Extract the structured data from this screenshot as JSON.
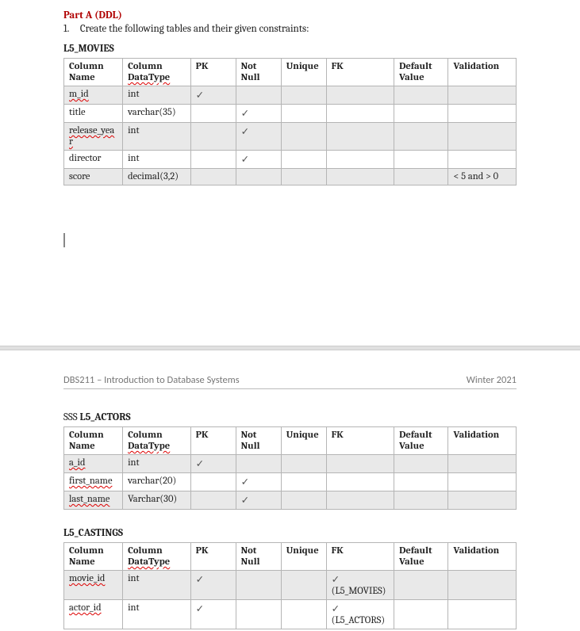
{
  "partA": {
    "title": "Part A (DDL)",
    "item1_num": "1.",
    "item1_text": "Create the following tables and their given constraints:"
  },
  "headers": {
    "col_name": "Column Name",
    "col_type": "Column ",
    "col_type2": "DataType",
    "pk": "PK",
    "not_null": "Not Null",
    "unique": "Unique",
    "fk": "FK",
    "default": "Default Value",
    "validation": "Validation"
  },
  "check": "✓",
  "movies": {
    "caption": "L5_MOVIES",
    "rows": [
      {
        "name": "m_id",
        "name_err": true,
        "type": "int",
        "pk": true,
        "nn": false,
        "uq": "",
        "fk": "",
        "def": "",
        "val": ""
      },
      {
        "name": "title",
        "name_err": false,
        "type": "varchar(35)",
        "pk": false,
        "nn": true,
        "uq": "",
        "fk": "",
        "def": "",
        "val": ""
      },
      {
        "name": "release_year",
        "name_err": true,
        "type": "int",
        "pk": false,
        "nn": true,
        "uq": "",
        "fk": "",
        "def": "",
        "val": ""
      },
      {
        "name": "director",
        "name_err": false,
        "type": "int",
        "pk": false,
        "nn": true,
        "uq": "",
        "fk": "",
        "def": "",
        "val": ""
      },
      {
        "name": "score",
        "name_err": false,
        "type": "decimal(3,2)",
        "pk": false,
        "nn": false,
        "uq": "",
        "fk": "",
        "def": "",
        "val": "< 5 and > 0"
      }
    ]
  },
  "actors": {
    "caption_prefix": "SSS ",
    "caption": "L5_ACTORS",
    "rows": [
      {
        "name": "a_id",
        "name_err": true,
        "type": "int",
        "pk": true,
        "nn": false,
        "uq": "",
        "fk": "",
        "def": "",
        "val": ""
      },
      {
        "name": "first_name",
        "name_err": true,
        "type": "varchar(20)",
        "pk": false,
        "nn": true,
        "uq": "",
        "fk": "",
        "def": "",
        "val": ""
      },
      {
        "name": "last_name",
        "name_err": true,
        "type": "Varchar(30)",
        "pk": false,
        "nn": true,
        "uq": "",
        "fk": "",
        "def": "",
        "val": ""
      }
    ]
  },
  "castings": {
    "caption": "L5_CASTINGS",
    "rows": [
      {
        "name": "movie_id",
        "name_err": true,
        "type": "int",
        "pk": true,
        "nn": false,
        "uq": "",
        "fk_chk": true,
        "fk_ref": "(L5_MOVIES)",
        "def": "",
        "val": ""
      },
      {
        "name": "actor_id",
        "name_err": true,
        "type": "int",
        "pk": true,
        "nn": false,
        "uq": "",
        "fk_chk": true,
        "fk_ref": "(L5_ACTORS)",
        "def": "",
        "val": ""
      }
    ]
  },
  "footer": {
    "left": "DBS211 – Introduction to Database Systems",
    "right": "Winter 2021"
  }
}
